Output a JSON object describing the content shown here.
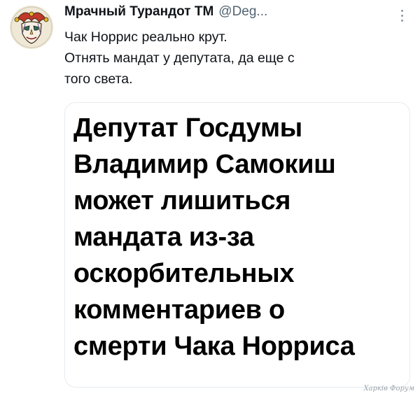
{
  "tweet": {
    "author": {
      "display_name": "Мрачный Турандот ТМ",
      "handle": "@Deg...",
      "avatar_icon": "jester-mask-avatar"
    },
    "text_lines": [
      "Чак Норрис реально крут.",
      "Отнять мандат у депутата, да еще с",
      "того света."
    ],
    "more_icon": "more-vertical-icon"
  },
  "card": {
    "headline_lines": [
      "Депутат Госдумы",
      "Владимир Самокиш",
      "может лишиться",
      "мандата из-за",
      "оскорбительных",
      "комментариев о",
      "смерти Чака Норриса"
    ]
  },
  "watermark": "Харків Форум",
  "colors": {
    "text": "#0f1419",
    "secondary": "#536471",
    "border": "#e6ecf0"
  }
}
